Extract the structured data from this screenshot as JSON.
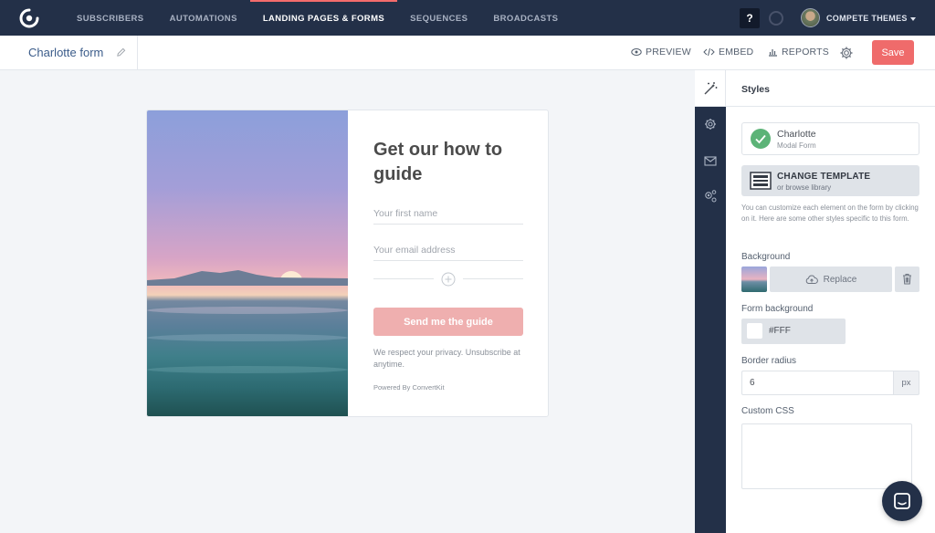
{
  "nav": {
    "items": [
      {
        "label": "SUBSCRIBERS",
        "active": false
      },
      {
        "label": "AUTOMATIONS",
        "active": false
      },
      {
        "label": "LANDING PAGES & FORMS",
        "active": true
      },
      {
        "label": "SEQUENCES",
        "active": false
      },
      {
        "label": "BROADCASTS",
        "active": false
      }
    ],
    "help_label": "?",
    "account_label": "COMPETE THEMES"
  },
  "subheader": {
    "form_name": "Charlotte form",
    "preview_label": "PREVIEW",
    "embed_label": "EMBED",
    "reports_label": "REPORTS",
    "save_label": "Save"
  },
  "form": {
    "title": "Get our how to guide",
    "first_name_placeholder": "Your first name",
    "email_placeholder": "Your email address",
    "submit_label": "Send me the guide",
    "privacy_text": "We respect your privacy. Unsubscribe at anytime.",
    "powered_by": "Powered By ConvertKit"
  },
  "panel": {
    "title": "Styles",
    "template_name": "Charlotte",
    "template_type": "Modal Form",
    "change_template_label": "CHANGE TEMPLATE",
    "change_template_sub": "or browse library",
    "help_text": "You can customize each element on the form by clicking on it. Here are some other styles specific to this form.",
    "background_label": "Background",
    "replace_label": "Replace",
    "form_background_label": "Form background",
    "form_background_value": "#FFF",
    "border_radius_label": "Border radius",
    "border_radius_value": "6",
    "border_radius_unit": "px",
    "custom_css_label": "Custom CSS",
    "custom_css_value": ""
  },
  "colors": {
    "nav_bg": "#233048",
    "accent": "#ef6b6b",
    "submit": "#efafaf",
    "link": "#3b5c8a"
  },
  "icons": [
    "logo-icon",
    "pencil-icon",
    "eye-icon",
    "code-icon",
    "bar-chart-icon",
    "gear-icon",
    "magic-wand-icon",
    "envelope-icon",
    "check-icon",
    "template-icon",
    "cloud-upload-icon",
    "trash-icon",
    "plus-circle-icon",
    "chat-icon"
  ]
}
